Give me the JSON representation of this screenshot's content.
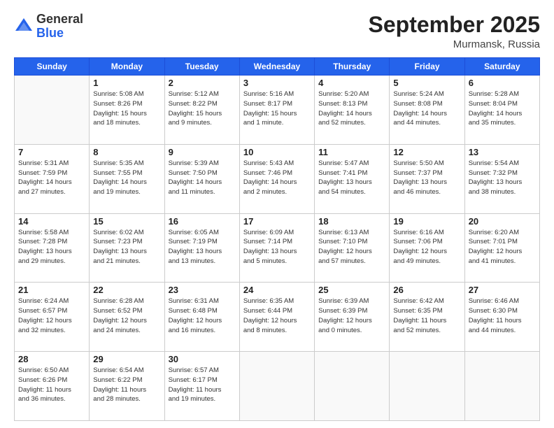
{
  "header": {
    "logo": {
      "general": "General",
      "blue": "Blue"
    },
    "title": "September 2025",
    "location": "Murmansk, Russia"
  },
  "weekdays": [
    "Sunday",
    "Monday",
    "Tuesday",
    "Wednesday",
    "Thursday",
    "Friday",
    "Saturday"
  ],
  "weeks": [
    [
      {
        "day": "",
        "info": ""
      },
      {
        "day": "1",
        "info": "Sunrise: 5:08 AM\nSunset: 8:26 PM\nDaylight: 15 hours\nand 18 minutes."
      },
      {
        "day": "2",
        "info": "Sunrise: 5:12 AM\nSunset: 8:22 PM\nDaylight: 15 hours\nand 9 minutes."
      },
      {
        "day": "3",
        "info": "Sunrise: 5:16 AM\nSunset: 8:17 PM\nDaylight: 15 hours\nand 1 minute."
      },
      {
        "day": "4",
        "info": "Sunrise: 5:20 AM\nSunset: 8:13 PM\nDaylight: 14 hours\nand 52 minutes."
      },
      {
        "day": "5",
        "info": "Sunrise: 5:24 AM\nSunset: 8:08 PM\nDaylight: 14 hours\nand 44 minutes."
      },
      {
        "day": "6",
        "info": "Sunrise: 5:28 AM\nSunset: 8:04 PM\nDaylight: 14 hours\nand 35 minutes."
      }
    ],
    [
      {
        "day": "7",
        "info": "Sunrise: 5:31 AM\nSunset: 7:59 PM\nDaylight: 14 hours\nand 27 minutes."
      },
      {
        "day": "8",
        "info": "Sunrise: 5:35 AM\nSunset: 7:55 PM\nDaylight: 14 hours\nand 19 minutes."
      },
      {
        "day": "9",
        "info": "Sunrise: 5:39 AM\nSunset: 7:50 PM\nDaylight: 14 hours\nand 11 minutes."
      },
      {
        "day": "10",
        "info": "Sunrise: 5:43 AM\nSunset: 7:46 PM\nDaylight: 14 hours\nand 2 minutes."
      },
      {
        "day": "11",
        "info": "Sunrise: 5:47 AM\nSunset: 7:41 PM\nDaylight: 13 hours\nand 54 minutes."
      },
      {
        "day": "12",
        "info": "Sunrise: 5:50 AM\nSunset: 7:37 PM\nDaylight: 13 hours\nand 46 minutes."
      },
      {
        "day": "13",
        "info": "Sunrise: 5:54 AM\nSunset: 7:32 PM\nDaylight: 13 hours\nand 38 minutes."
      }
    ],
    [
      {
        "day": "14",
        "info": "Sunrise: 5:58 AM\nSunset: 7:28 PM\nDaylight: 13 hours\nand 29 minutes."
      },
      {
        "day": "15",
        "info": "Sunrise: 6:02 AM\nSunset: 7:23 PM\nDaylight: 13 hours\nand 21 minutes."
      },
      {
        "day": "16",
        "info": "Sunrise: 6:05 AM\nSunset: 7:19 PM\nDaylight: 13 hours\nand 13 minutes."
      },
      {
        "day": "17",
        "info": "Sunrise: 6:09 AM\nSunset: 7:14 PM\nDaylight: 13 hours\nand 5 minutes."
      },
      {
        "day": "18",
        "info": "Sunrise: 6:13 AM\nSunset: 7:10 PM\nDaylight: 12 hours\nand 57 minutes."
      },
      {
        "day": "19",
        "info": "Sunrise: 6:16 AM\nSunset: 7:06 PM\nDaylight: 12 hours\nand 49 minutes."
      },
      {
        "day": "20",
        "info": "Sunrise: 6:20 AM\nSunset: 7:01 PM\nDaylight: 12 hours\nand 41 minutes."
      }
    ],
    [
      {
        "day": "21",
        "info": "Sunrise: 6:24 AM\nSunset: 6:57 PM\nDaylight: 12 hours\nand 32 minutes."
      },
      {
        "day": "22",
        "info": "Sunrise: 6:28 AM\nSunset: 6:52 PM\nDaylight: 12 hours\nand 24 minutes."
      },
      {
        "day": "23",
        "info": "Sunrise: 6:31 AM\nSunset: 6:48 PM\nDaylight: 12 hours\nand 16 minutes."
      },
      {
        "day": "24",
        "info": "Sunrise: 6:35 AM\nSunset: 6:44 PM\nDaylight: 12 hours\nand 8 minutes."
      },
      {
        "day": "25",
        "info": "Sunrise: 6:39 AM\nSunset: 6:39 PM\nDaylight: 12 hours\nand 0 minutes."
      },
      {
        "day": "26",
        "info": "Sunrise: 6:42 AM\nSunset: 6:35 PM\nDaylight: 11 hours\nand 52 minutes."
      },
      {
        "day": "27",
        "info": "Sunrise: 6:46 AM\nSunset: 6:30 PM\nDaylight: 11 hours\nand 44 minutes."
      }
    ],
    [
      {
        "day": "28",
        "info": "Sunrise: 6:50 AM\nSunset: 6:26 PM\nDaylight: 11 hours\nand 36 minutes."
      },
      {
        "day": "29",
        "info": "Sunrise: 6:54 AM\nSunset: 6:22 PM\nDaylight: 11 hours\nand 28 minutes."
      },
      {
        "day": "30",
        "info": "Sunrise: 6:57 AM\nSunset: 6:17 PM\nDaylight: 11 hours\nand 19 minutes."
      },
      {
        "day": "",
        "info": ""
      },
      {
        "day": "",
        "info": ""
      },
      {
        "day": "",
        "info": ""
      },
      {
        "day": "",
        "info": ""
      }
    ]
  ]
}
